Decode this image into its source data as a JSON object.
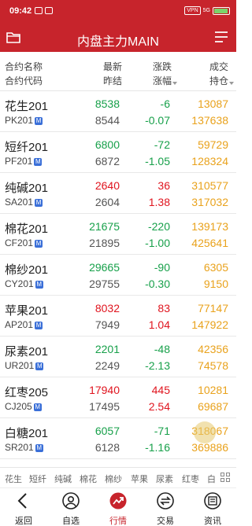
{
  "status_bar": {
    "time": "09:42",
    "indicators": [
      "VPN",
      "5G",
      "92"
    ]
  },
  "header": {
    "title": "内盘主力MAIN",
    "left_icon": "folder-icon",
    "right_icon": "menu-icon"
  },
  "columns": {
    "col1_line1": "合约名称",
    "col1_line2": "合约代码",
    "col2_line1": "最新",
    "col2_line2": "昨结",
    "col3_line1": "涨跌",
    "col3_line2": "涨幅",
    "col4_line1": "成交",
    "col4_line2": "持仓"
  },
  "badge_label": "M",
  "rows": [
    {
      "name": "花生201",
      "code": "PK201",
      "price": "8538",
      "prev": "8544",
      "change": "-6",
      "pct": "-0.07",
      "volume": "13087",
      "open_interest": "137638",
      "dir": "down"
    },
    {
      "name": "短纤201",
      "code": "PF201",
      "price": "6800",
      "prev": "6872",
      "change": "-72",
      "pct": "-1.05",
      "volume": "59729",
      "open_interest": "128324",
      "dir": "down"
    },
    {
      "name": "纯碱201",
      "code": "SA201",
      "price": "2640",
      "prev": "2604",
      "change": "36",
      "pct": "1.38",
      "volume": "310577",
      "open_interest": "317032",
      "dir": "up"
    },
    {
      "name": "棉花201",
      "code": "CF201",
      "price": "21675",
      "prev": "21895",
      "change": "-220",
      "pct": "-1.00",
      "volume": "139173",
      "open_interest": "425641",
      "dir": "down"
    },
    {
      "name": "棉纱201",
      "code": "CY201",
      "price": "29665",
      "prev": "29755",
      "change": "-90",
      "pct": "-0.30",
      "volume": "6305",
      "open_interest": "9150",
      "dir": "down"
    },
    {
      "name": "苹果201",
      "code": "AP201",
      "price": "8032",
      "prev": "7949",
      "change": "83",
      "pct": "1.04",
      "volume": "77147",
      "open_interest": "147922",
      "dir": "up"
    },
    {
      "name": "尿素201",
      "code": "UR201",
      "price": "2201",
      "prev": "2249",
      "change": "-48",
      "pct": "-2.13",
      "volume": "42356",
      "open_interest": "74578",
      "dir": "down"
    },
    {
      "name": "红枣205",
      "code": "CJ205",
      "price": "17940",
      "prev": "17495",
      "change": "445",
      "pct": "2.54",
      "volume": "10281",
      "open_interest": "69687",
      "dir": "up"
    },
    {
      "name": "白糖201",
      "code": "SR201",
      "price": "6057",
      "prev": "6128",
      "change": "-71",
      "pct": "-1.16",
      "volume": "318067",
      "open_interest": "369886",
      "dir": "down"
    }
  ],
  "categories": [
    "花生",
    "短纤",
    "纯碱",
    "棉花",
    "棉纱",
    "苹果",
    "尿素",
    "红枣",
    "白"
  ],
  "nav": [
    {
      "label": "返回",
      "icon": "back-icon"
    },
    {
      "label": "自选",
      "icon": "person-icon"
    },
    {
      "label": "行情",
      "icon": "trend-icon"
    },
    {
      "label": "交易",
      "icon": "trade-icon"
    },
    {
      "label": "资讯",
      "icon": "news-icon"
    }
  ],
  "colors": {
    "brand_red": "#c7242c",
    "up": "#e0141e",
    "down": "#17a04a",
    "volume": "#e9a21c",
    "badge": "#3a6fd8"
  }
}
